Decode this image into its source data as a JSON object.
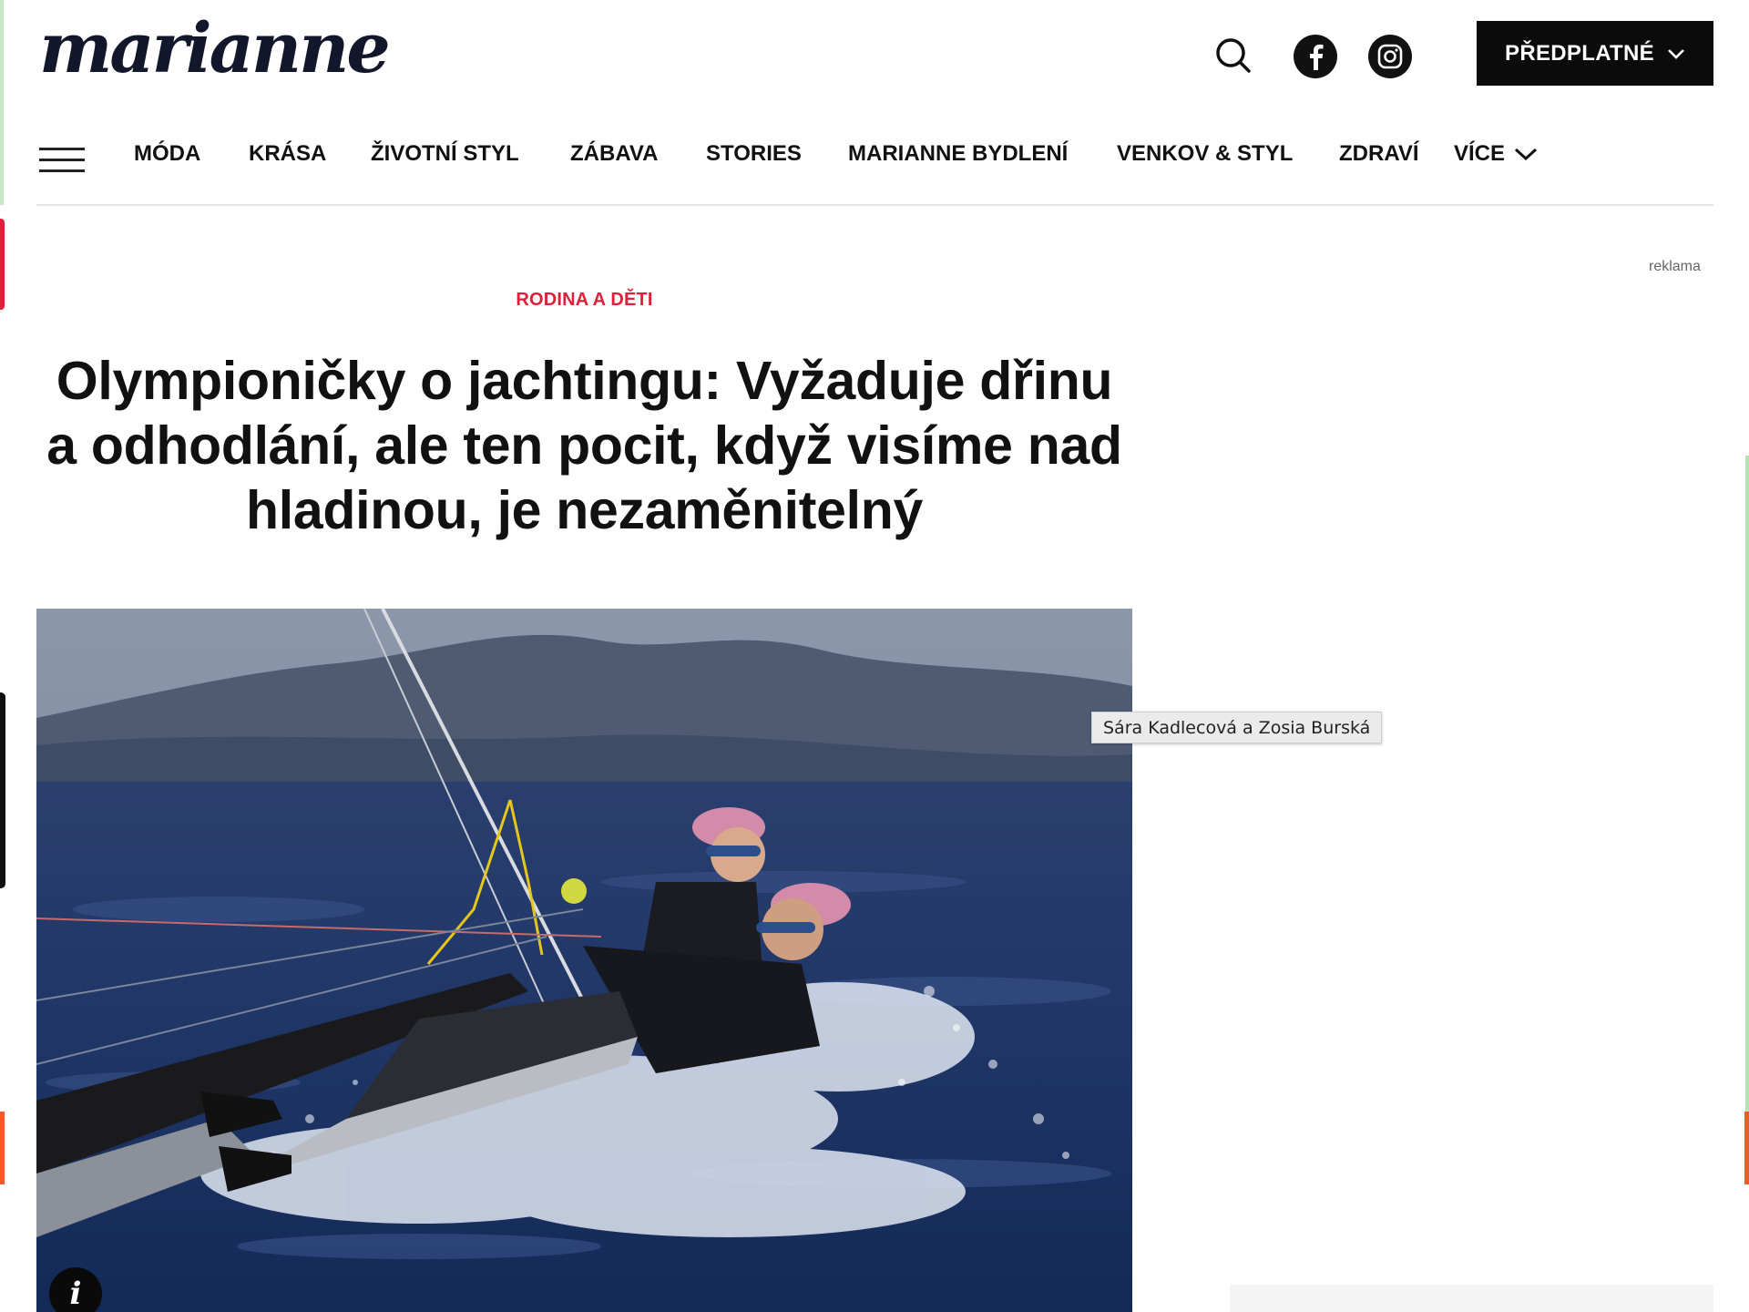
{
  "brand": {
    "logo_text": "marianne"
  },
  "header": {
    "search_icon": "search-icon",
    "facebook_icon": "facebook-icon",
    "instagram_icon": "instagram-icon",
    "subscribe_label": "PŘEDPLATNÉ"
  },
  "nav": {
    "items": [
      "MÓDA",
      "KRÁSA",
      "ŽIVOTNÍ STYL",
      "ZÁBAVA",
      "STORIES",
      "MARIANNE BYDLENÍ",
      "VENKOV & STYL",
      "ZDRAVÍ"
    ],
    "more_label": "VÍCE"
  },
  "ad": {
    "label": "reklama"
  },
  "article": {
    "category": "RODINA A DĚTI",
    "title": "Olympioničky o jachtingu: Vyžaduje dřinu a odhodlání, ale ten pocit, když visíme nad hladinou, je nezaměnitelný",
    "image_tooltip": "Sára Kadlecová a Zosia Burská"
  },
  "colors": {
    "accent": "#e0203a",
    "dark": "#0b0b0b",
    "logo": "#12172b"
  }
}
